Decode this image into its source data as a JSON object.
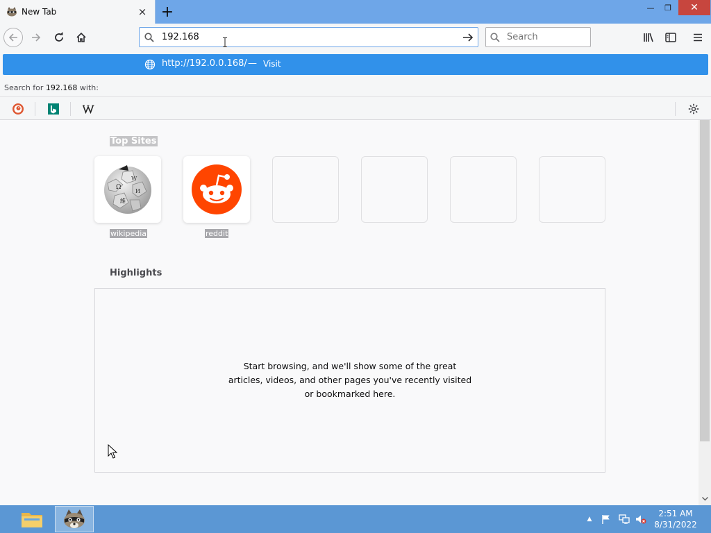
{
  "tab": {
    "title": "New Tab",
    "close_label": "×"
  },
  "toolbar": {
    "new_tab_label": "+"
  },
  "window": {
    "minimize": "—",
    "restore": "❐",
    "close": "✕"
  },
  "nav": {
    "url_value": "192.168",
    "search_placeholder": "Search"
  },
  "dropdown": {
    "suggestion_url": "http://192.0.0.168/",
    "suggestion_sep": "—",
    "suggestion_action": "Visit",
    "search_for_prefix": "Search for ",
    "search_for_term": "192.168",
    "search_for_suffix": " with:",
    "engines": [
      "DuckDuckGo",
      "Bing",
      "Wikipedia"
    ]
  },
  "content": {
    "top_sites_title": "Top Sites",
    "sites": [
      {
        "label": "wikipedia"
      },
      {
        "label": "reddit"
      }
    ],
    "highlights_title": "Highlights",
    "highlights_message": "Start browsing, and we'll show some of the great articles, videos, and other pages you've recently visited or bookmarked here."
  },
  "taskbar": {
    "time": "2:51 AM",
    "date": "8/31/2022"
  },
  "colors": {
    "accent": "#3191ea",
    "tabbar": "#6ea6e8",
    "reddit": "#ff4500",
    "taskbar": "#5b97d4"
  }
}
